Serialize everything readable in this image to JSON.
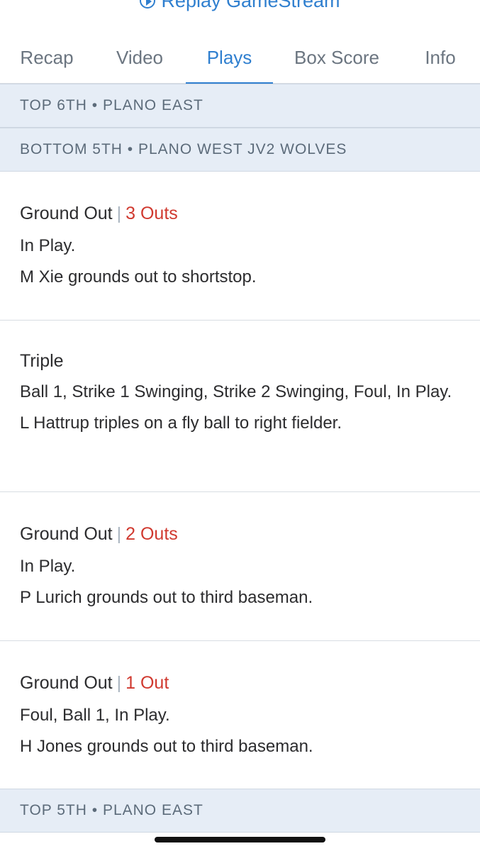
{
  "top_link": {
    "label": "Replay GameStream",
    "icon": "play-circle-icon"
  },
  "tabs": [
    {
      "label": "Recap",
      "active": false
    },
    {
      "label": "Video",
      "active": false
    },
    {
      "label": "Plays",
      "active": true
    },
    {
      "label": "Box Score",
      "active": false
    },
    {
      "label": "Info",
      "active": false
    }
  ],
  "sections": {
    "top6": "TOP 6TH • PLANO EAST",
    "bottom5": "BOTTOM 5TH • PLANO WEST JV2 WOLVES",
    "top5": "TOP 5TH • PLANO EAST"
  },
  "plays": [
    {
      "title": "Ground Out",
      "separator": "|",
      "outs": "3 Outs",
      "pitches": "In Play.",
      "description": "M Xie grounds out to shortstop."
    },
    {
      "title": "Triple",
      "separator": "",
      "outs": "",
      "pitches": "Ball 1, Strike 1 Swinging, Strike 2 Swinging, Foul, In Play.",
      "description": "L Hattrup triples on a fly ball to right fielder."
    },
    {
      "title": "Ground Out",
      "separator": "|",
      "outs": "2 Outs",
      "pitches": "In Play.",
      "description": "P Lurich grounds out to third baseman."
    },
    {
      "title": "Ground Out",
      "separator": "|",
      "outs": "1 Out",
      "pitches": "Foul, Ball 1, In Play.",
      "description": "H Jones grounds out to third baseman."
    }
  ],
  "colors": {
    "accent": "#2f7fcf",
    "outs": "#d0392f",
    "section_bg": "#e6edf6"
  }
}
